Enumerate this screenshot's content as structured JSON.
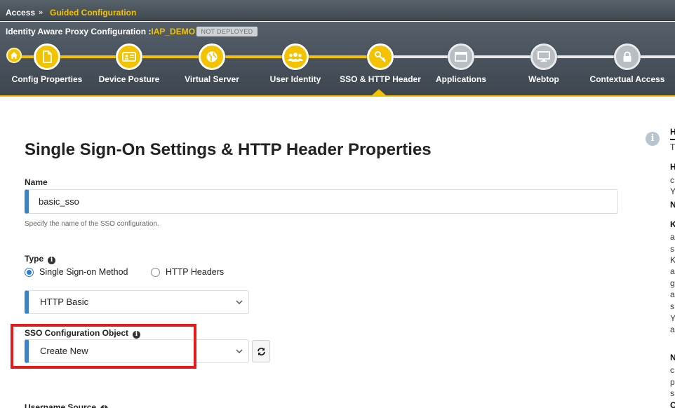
{
  "breadcrumb": {
    "root": "Access",
    "separator": "»",
    "current": "Guided Configuration"
  },
  "header": {
    "title_prefix": "Identity Aware Proxy Configuration :",
    "config_name": "IAP_DEMO",
    "deploy_status": "NOT DEPLOYED"
  },
  "colors": {
    "accent": "#f3c300",
    "header_bg": "#4a535b",
    "input_accent": "#3b82c9",
    "highlight": "#e31b1b"
  },
  "steps": [
    {
      "label": "Config Properties",
      "icon": "document-icon",
      "state": "done"
    },
    {
      "label": "Device Posture",
      "icon": "id-card-icon",
      "state": "done"
    },
    {
      "label": "Virtual Server",
      "icon": "globe-icon",
      "state": "done"
    },
    {
      "label": "User Identity",
      "icon": "users-icon",
      "state": "done"
    },
    {
      "label": "SSO & HTTP Header",
      "icon": "key-icon",
      "state": "active"
    },
    {
      "label": "Applications",
      "icon": "window-icon",
      "state": "todo"
    },
    {
      "label": "Webtop",
      "icon": "monitor-icon",
      "state": "todo"
    },
    {
      "label": "Contextual Access",
      "icon": "lock-icon",
      "state": "todo"
    }
  ],
  "form": {
    "title": "Single Sign-On Settings & HTTP Header Properties",
    "name_label": "Name",
    "name_value": "basic_sso",
    "name_help": "Specify the name of the SSO configuration.",
    "type_label": "Type",
    "type_options": [
      "Single Sign-on Method",
      "HTTP Headers"
    ],
    "type_selected": "Single Sign-on Method",
    "method_value": "HTTP Basic",
    "sso_object_label": "SSO Configuration Object",
    "sso_object_value": "Create New",
    "username_source_label": "Username Source"
  },
  "help_panel": {
    "chars": [
      "H",
      "T",
      "H",
      "c",
      "Y",
      "N",
      "K",
      "a",
      "s",
      "K",
      "a",
      "g",
      "a",
      "s",
      "Y",
      "a",
      "N",
      "c",
      "p",
      "s",
      "C"
    ]
  }
}
